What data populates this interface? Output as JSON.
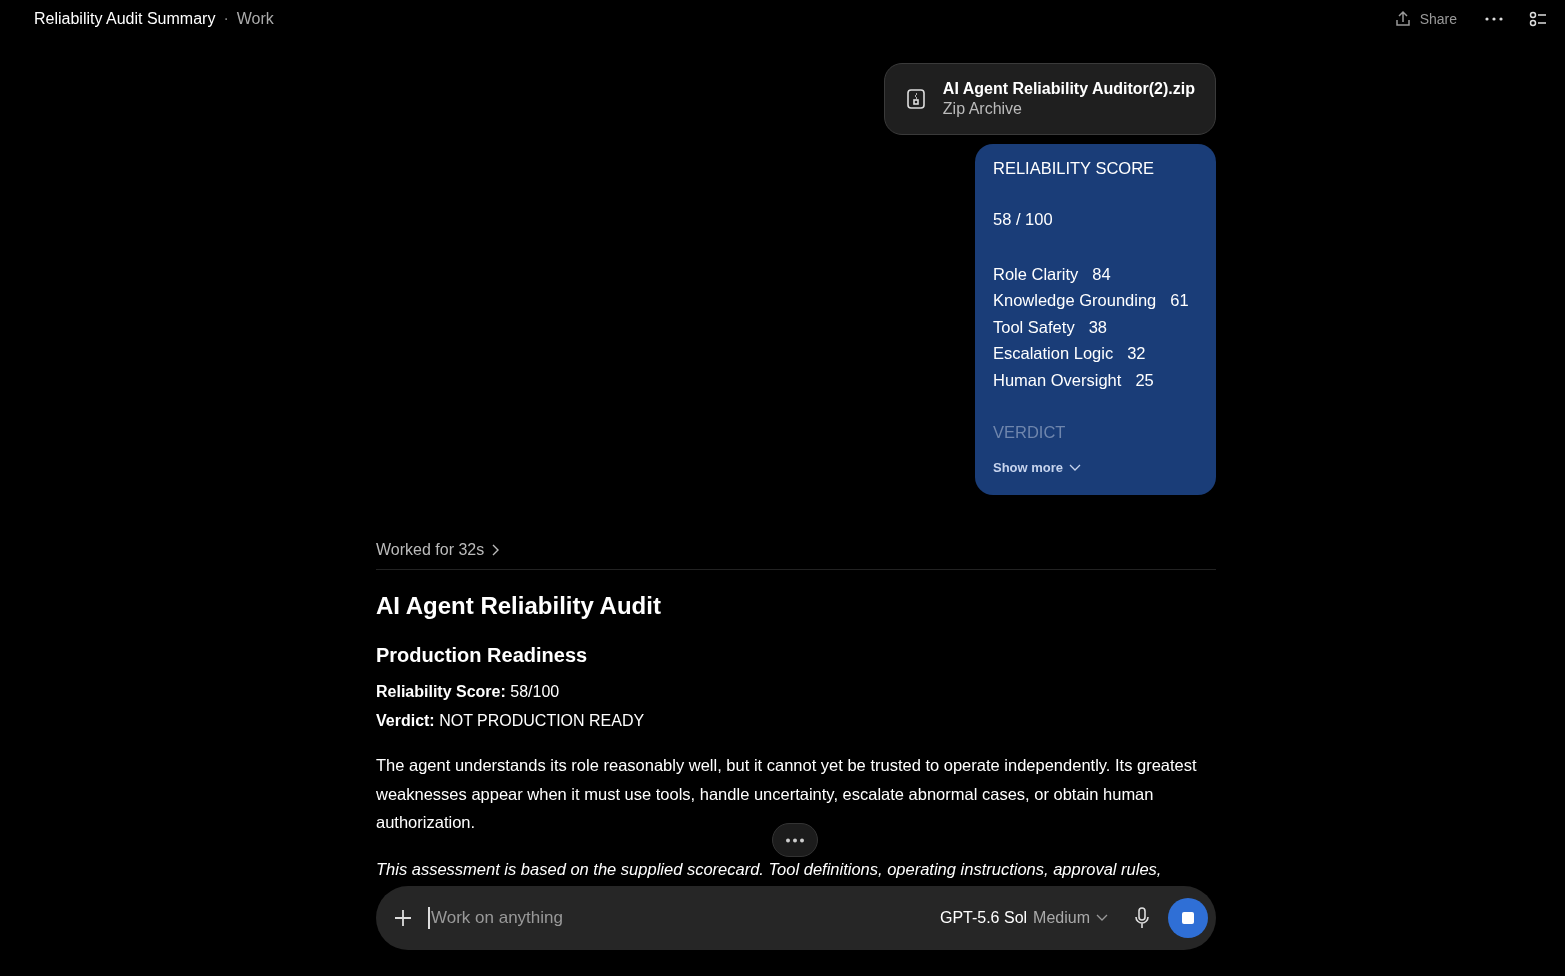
{
  "header": {
    "title": "Reliability Audit Summary",
    "separator": "·",
    "project": "Work",
    "share": "Share"
  },
  "attachment": {
    "name": "AI Agent Reliability Auditor(2).zip",
    "type": "Zip Archive"
  },
  "score_card": {
    "heading": "RELIABILITY SCORE",
    "score": "58 / 100",
    "rows": [
      {
        "label": "Role Clarity",
        "value": "84"
      },
      {
        "label": "Knowledge Grounding",
        "value": "61"
      },
      {
        "label": "Tool Safety",
        "value": "38"
      },
      {
        "label": "Escalation Logic",
        "value": "32"
      },
      {
        "label": "Human Oversight",
        "value": "25"
      }
    ],
    "faded_heading": "VERDICT",
    "show_more": "Show more"
  },
  "worked": "Worked for 32s",
  "response": {
    "title": "AI Agent Reliability Audit",
    "subtitle": "Production Readiness",
    "facts": [
      "**Reliability Score:** 58/100",
      "**Verdict:** NOT PRODUCTION READY"
    ],
    "paragraph": "The agent understands its role reasonably well, but it cannot yet be trusted to operate independently. Its greatest weaknesses appear when it must use tools, handle uncertainty, escalate abnormal cases, or obtain human authorization.",
    "note": "This assessment is based on the supplied scorecard. Tool definitions, operating instructions, approval rules,"
  },
  "composer": {
    "placeholder": "Work on anything",
    "model": "GPT-5.6 Sol",
    "effort": "Medium"
  }
}
